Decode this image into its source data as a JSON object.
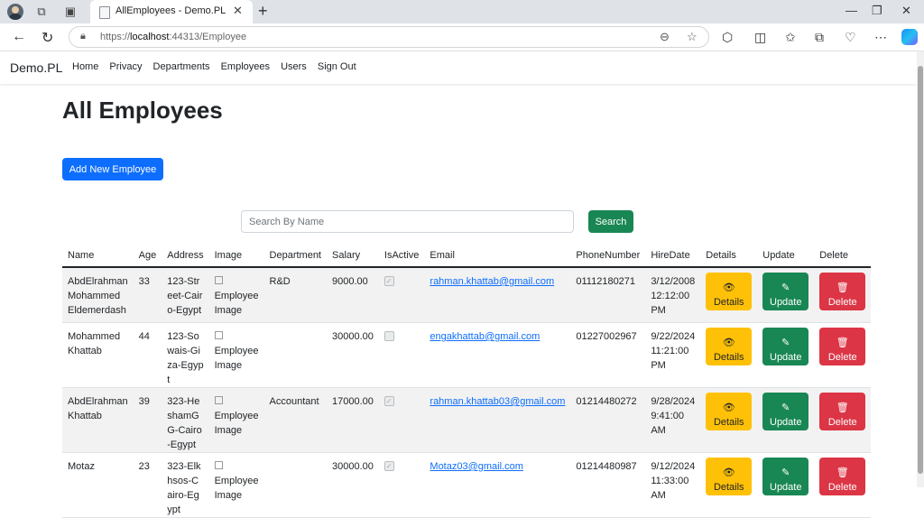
{
  "browser": {
    "tab_title": "AllEmployees - Demo.PL",
    "url_scheme": "https://",
    "url_host": "localhost",
    "url_rest": ":44313/Employee"
  },
  "site": {
    "brand": "Demo.PL",
    "nav": [
      "Home",
      "Privacy",
      "Departments",
      "Employees",
      "Users",
      "Sign Out"
    ]
  },
  "page": {
    "title": "All Employees",
    "add_button": "Add New Employee",
    "search_placeholder": "Search By Name",
    "search_button": "Search"
  },
  "table": {
    "headers": [
      "Name",
      "Age",
      "Address",
      "Image",
      "Department",
      "Salary",
      "IsActive",
      "Email",
      "PhoneNumber",
      "HireDate",
      "Details",
      "Update",
      "Delete"
    ],
    "image_alt": "Employee Image",
    "details_label": "Details",
    "update_label": "Update",
    "delete_label": "Delete",
    "rows": [
      {
        "name": "AbdElrahman Mohammed Eldemerdash",
        "age": "33",
        "address": "123-Street-Cairo-Egypt",
        "department": "R&D",
        "salary": "9000.00",
        "active": true,
        "email": "rahman.khattab@gmail.com",
        "phone": "01112180271",
        "hire": "3/12/2008 12:12:00 PM"
      },
      {
        "name": "Mohammed Khattab",
        "age": "44",
        "address": "123-Sowais-Giza-Egypt",
        "department": "",
        "salary": "30000.00",
        "active": false,
        "email": "engakhattab@gmail.com",
        "phone": "01227002967",
        "hire": "9/22/2024 11:21:00 PM"
      },
      {
        "name": "AbdElrahman Khattab",
        "age": "39",
        "address": "323-HeshamGG-Cairo-Egypt",
        "department": "Accountant",
        "salary": "17000.00",
        "active": true,
        "email": "rahman.khattab03@gmail.com",
        "phone": "01214480272",
        "hire": "9/28/2024 9:41:00 AM"
      },
      {
        "name": "Motaz",
        "age": "23",
        "address": "323-Elkhsos-Cairo-Egypt",
        "department": "",
        "salary": "30000.00",
        "active": true,
        "email": "Motaz03@gmail.com",
        "phone": "01214480987",
        "hire": "9/12/2024 11:33:00 AM"
      }
    ]
  }
}
